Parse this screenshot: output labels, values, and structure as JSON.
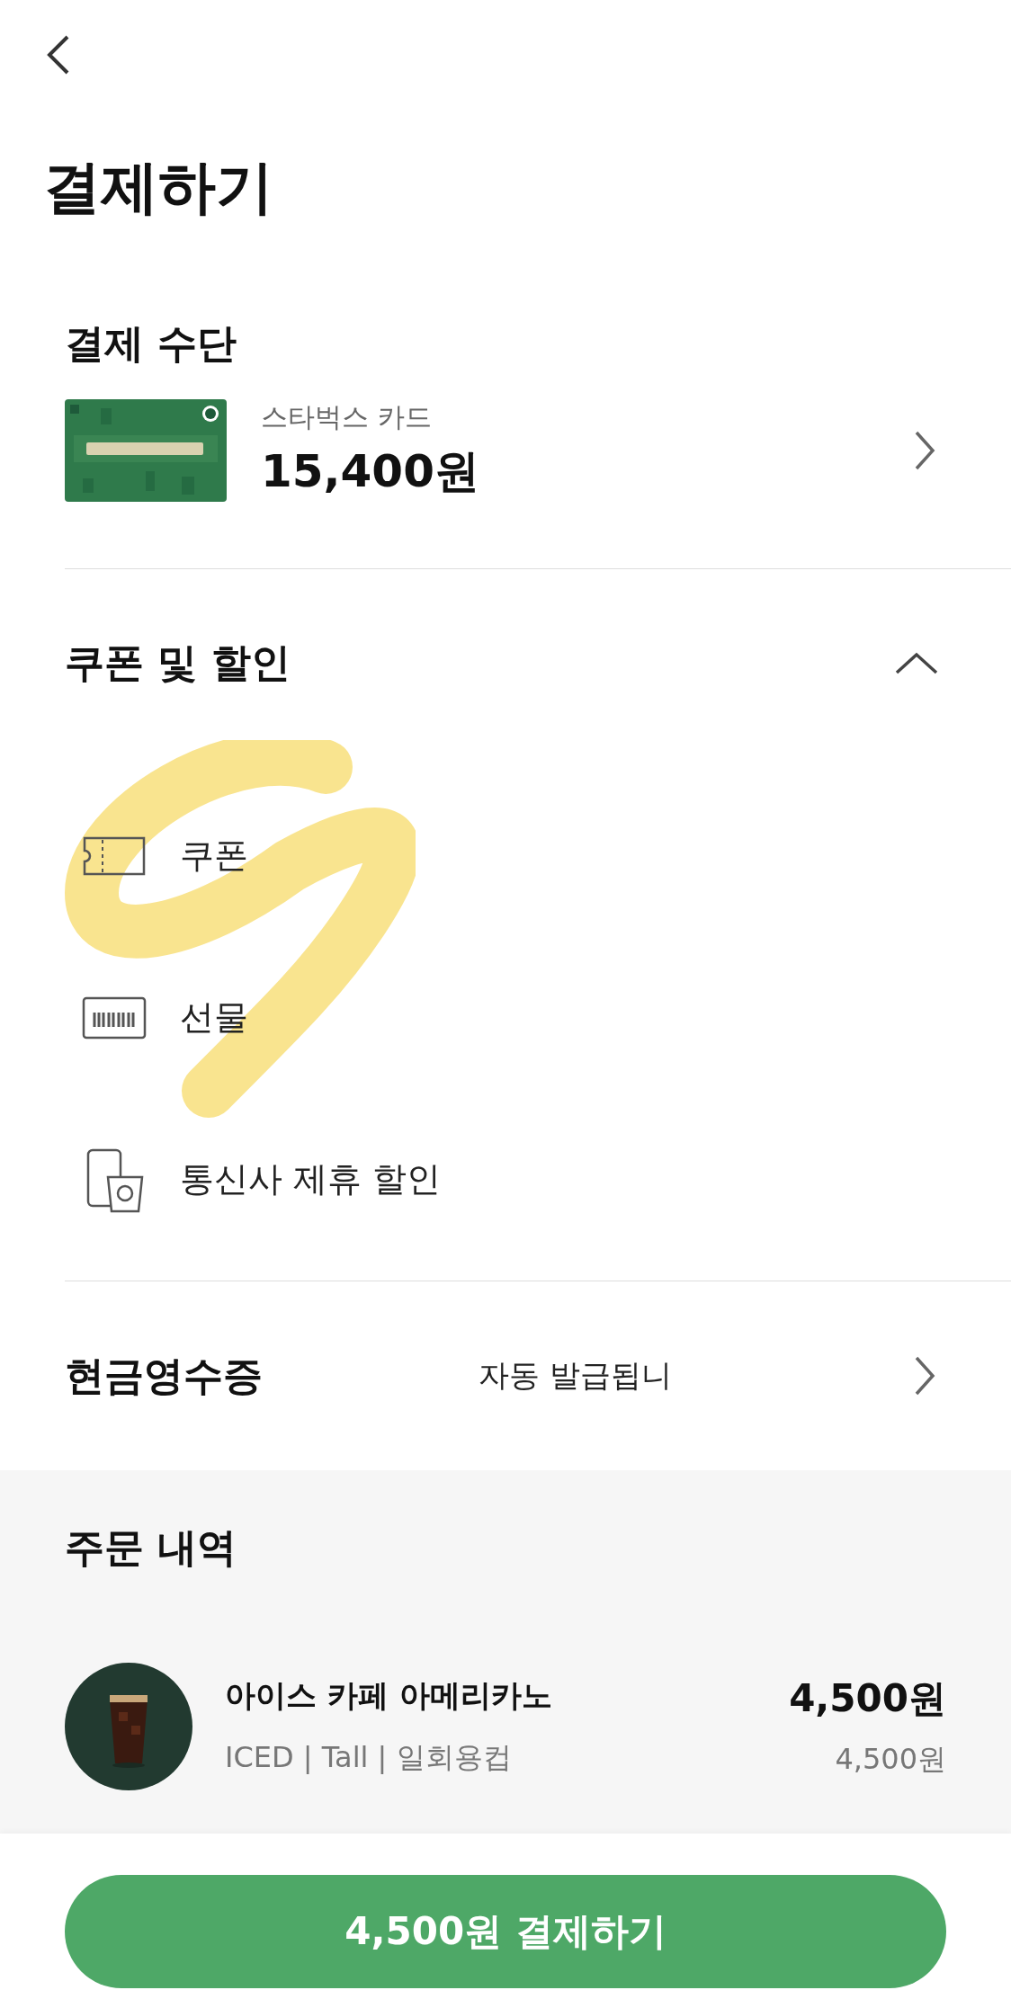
{
  "title": "결제하기",
  "payment": {
    "heading": "결제 수단",
    "card_name": "스타벅스 카드",
    "balance": "15,400원"
  },
  "discounts": {
    "heading": "쿠폰 및 할인",
    "expanded": true,
    "options": [
      {
        "kind": "coupon",
        "label": "쿠폰"
      },
      {
        "kind": "gift",
        "label": "선물"
      },
      {
        "kind": "telecom",
        "label": "통신사 제휴 할인"
      }
    ]
  },
  "receipt": {
    "heading": "현금영수증",
    "value": "자동 발급됩니"
  },
  "order": {
    "heading": "주문 내역",
    "items": [
      {
        "name": "아이스 카페 아메리카노",
        "options": "ICED | Tall | 일회용컵",
        "price": "4,500원",
        "unit_price": "4,500원"
      }
    ]
  },
  "pay_button": "4,500원 결제하기"
}
